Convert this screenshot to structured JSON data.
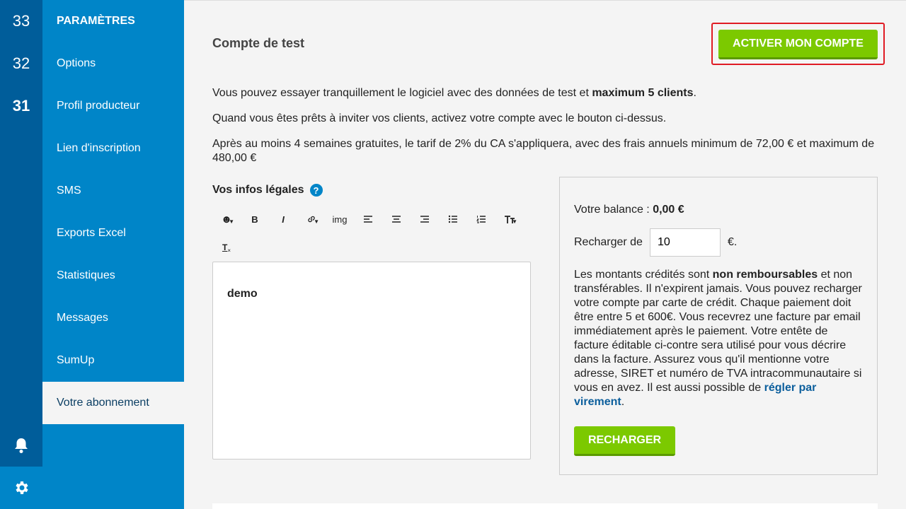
{
  "rail": {
    "numbers": [
      "33",
      "32",
      "31"
    ],
    "bell_icon": "bell-icon",
    "gear_icon": "gear-icon"
  },
  "sidebar": {
    "title": "PARAMÈTRES",
    "items": [
      {
        "label": "Options"
      },
      {
        "label": "Profil producteur"
      },
      {
        "label": "Lien d'inscription"
      },
      {
        "label": "SMS"
      },
      {
        "label": "Exports Excel"
      },
      {
        "label": "Statistiques"
      },
      {
        "label": "Messages"
      },
      {
        "label": "SumUp"
      },
      {
        "label": "Votre abonnement",
        "active": true
      }
    ]
  },
  "main": {
    "title": "Compte de test",
    "activate_button": "ACTIVER MON COMPTE",
    "p1_before": "Vous pouvez essayer tranquillement le logiciel avec des données de test et ",
    "p1_bold": "maximum 5 clients",
    "p1_after": ".",
    "p2": "Quand vous êtes prêts à inviter vos clients, activez votre compte avec le bouton ci-dessus.",
    "p3": "Après au moins 4 semaines gratuites, le tarif de 2% du CA s'appliquera, avec des frais annuels minimum de 72,00 € et maximum de 480,00 €"
  },
  "legal": {
    "title": "Vos infos légales",
    "help": "?",
    "toolbar": {
      "emoji": "☻",
      "bold": "B",
      "italic": "I",
      "link": "🔗",
      "img": "img",
      "clear_format": "T"
    },
    "editor_content": "demo"
  },
  "balance": {
    "label": "Votre balance : ",
    "value": "0,00 €",
    "recharge_label": "Recharger de",
    "recharge_value": "10",
    "currency": "€.",
    "text_1": "Les montants crédités sont ",
    "text_bold": "non remboursables",
    "text_2": " et non transférables. Il n'expirent jamais. Vous pouvez recharger votre compte par carte de crédit. Chaque paiement doit être entre 5 et 600€. Vous recevrez une facture par email immédiatement après le paiement. Votre entête de facture éditable ci-contre sera utilisé pour vous décrire dans la facture. Assurez vous qu'il mentionne votre adresse, SIRET et numéro de TVA intracommunautaire si vous en avez. Il est aussi possible de ",
    "link": "régler par virement",
    "text_3": ".",
    "recharge_button": "RECHARGER"
  },
  "colors": {
    "rail": "#005d9a",
    "sidebar": "#0085c8",
    "accent_green": "#7cc900",
    "highlight_red": "#e01b24"
  }
}
